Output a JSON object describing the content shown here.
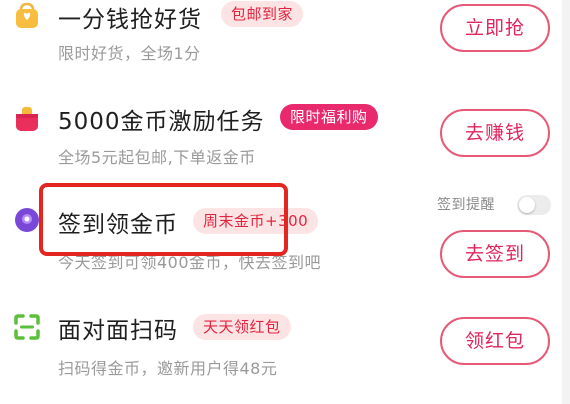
{
  "tasks": [
    {
      "title": "一分钱抢好货",
      "badge": "包邮到家",
      "subtitle": "限时好货，全场1分",
      "button": "立即抢",
      "icon": "shopping-bag-icon"
    },
    {
      "title": "5000金币激励任务",
      "badge": "限时福利购",
      "subtitle": "全场5元起包邮,下单返金币",
      "button": "去赚钱",
      "icon": "gift-box-icon"
    },
    {
      "title": "签到领金币",
      "badge": "周末金币+300",
      "subtitle": "今天签到可领400金币，快去签到吧",
      "button": "去签到",
      "icon": "location-pin-icon"
    },
    {
      "title": "面对面扫码",
      "badge": "天天领红包",
      "subtitle": "扫码得金币，邀新用户得48元",
      "button": "领红包",
      "icon": "scan-icon"
    }
  ],
  "reminder": {
    "label": "签到提醒",
    "enabled": false
  },
  "colors": {
    "accent": "#e0245d",
    "badge_bg": "#fde4e4",
    "badge_dark": "#e8296b",
    "highlight": "#e3261f"
  }
}
